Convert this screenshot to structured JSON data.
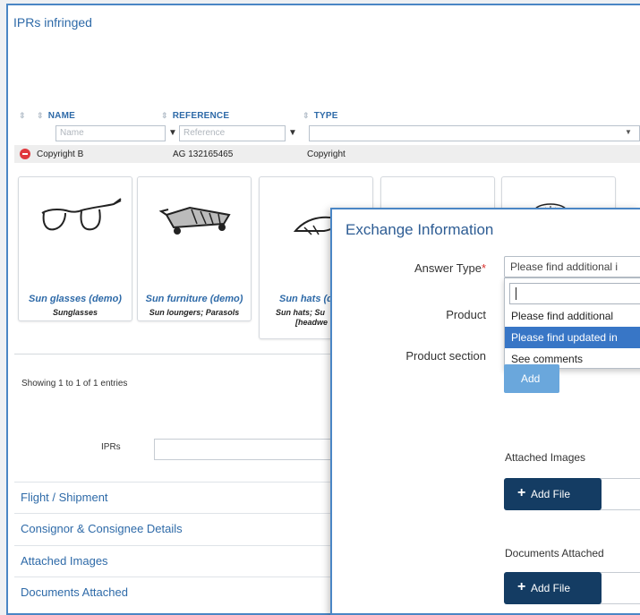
{
  "panel": {
    "title": "IPRs infringed"
  },
  "table": {
    "columns": [
      "NAME",
      "REFERENCE",
      "TYPE"
    ],
    "filter_placeholders": {
      "name": "Name",
      "reference": "Reference"
    },
    "rows": [
      {
        "name": "Copyright B",
        "reference": "AG 132165465",
        "type": "Copyright"
      }
    ]
  },
  "cards": [
    {
      "title": "Sun glasses (demo)",
      "subtitle": "Sunglasses",
      "icon": "sunglasses-icon"
    },
    {
      "title": "Sun furniture (demo)",
      "subtitle": "Sun loungers; Parasols",
      "icon": "sun-lounger-icon"
    },
    {
      "title": "Sun hats (d",
      "subtitle": "Sun hats; Su",
      "subtitle2": "[headwe",
      "icon": "sun-hat-icon"
    },
    {
      "title": "",
      "subtitle": "",
      "icon": "product-sketch-icon"
    },
    {
      "title": "",
      "subtitle": "",
      "icon": "product-sketch-icon"
    }
  ],
  "pagination": {
    "info": "Showing 1 to 1 of 1 entries"
  },
  "iprs_field": {
    "label": "IPRs"
  },
  "accordion": [
    "Flight / Shipment",
    "Consignor & Consignee Details",
    "Attached Images",
    "Documents Attached"
  ],
  "modal": {
    "title": "Exchange Information",
    "answer_type_label": "Answer Type",
    "required_mark": "*",
    "answer_type_value": "Please find additional i",
    "product_label": "Product",
    "product_section_label": "Product section",
    "dropdown_options": [
      "Please find additional",
      "Please find updated in",
      "See comments"
    ],
    "dropdown_selected_index": 1,
    "add_button": "Add",
    "attached_images_label": "Attached Images",
    "documents_attached_label": "Documents Attached",
    "add_file_button": "Add File"
  },
  "colors": {
    "accent": "#2e6aa8",
    "border": "#4a86c5",
    "dark_button": "#143c63",
    "add_button": "#6aa7dc",
    "selected_option": "#3876c6",
    "remove": "#e0393e"
  }
}
